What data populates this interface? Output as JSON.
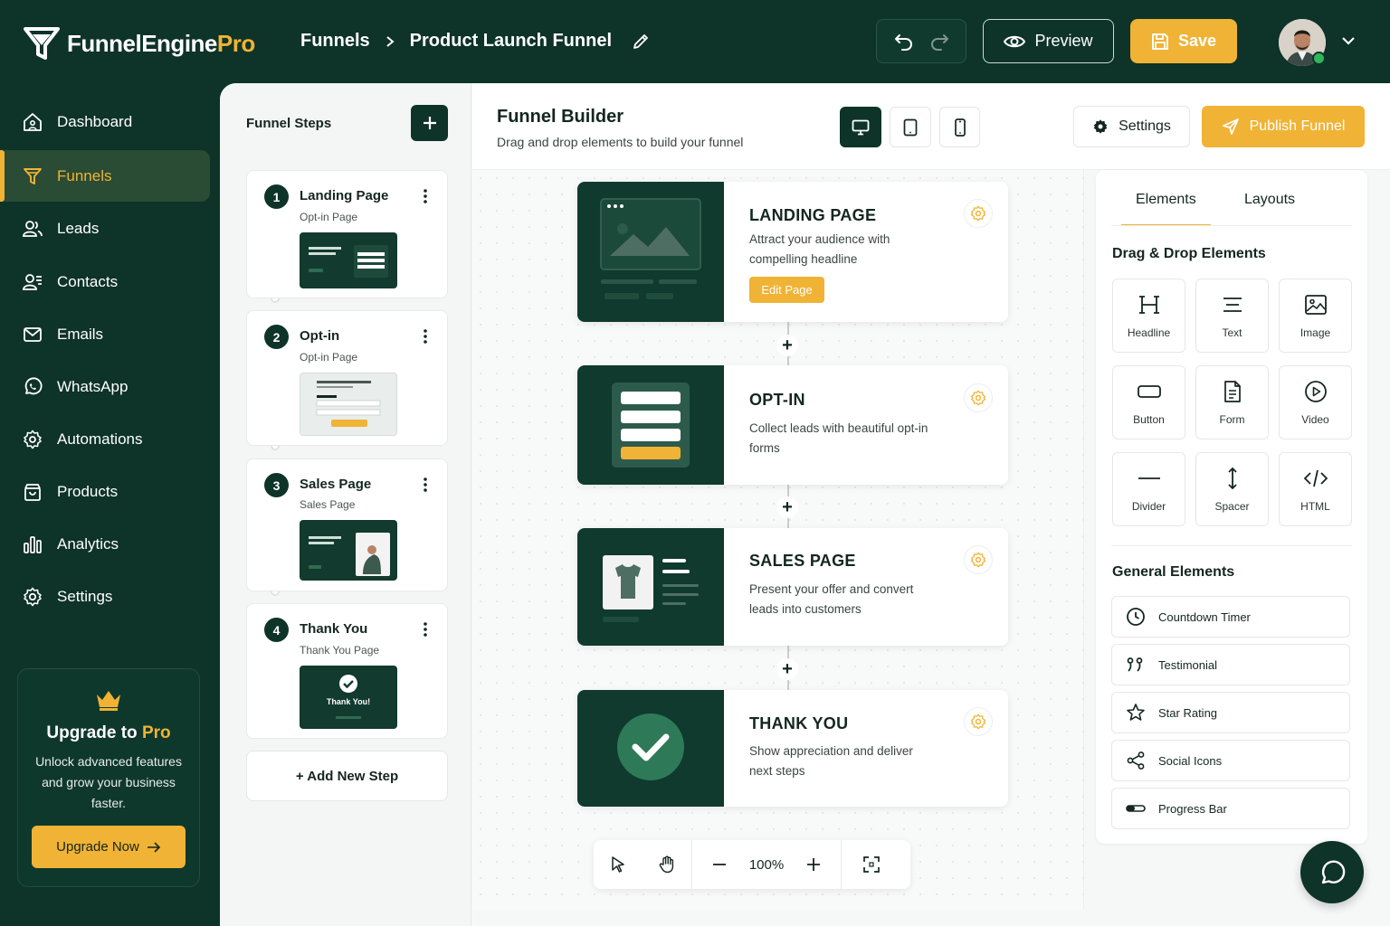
{
  "brand": {
    "name_main": "FunnelEngine",
    "name_accent": "Pro",
    "accent_color": "#f0b335",
    "dark_color": "#0e3328"
  },
  "header": {
    "breadcrumb_root": "Funnels",
    "breadcrumb_current": "Product Launch Funnel",
    "preview_label": "Preview",
    "save_label": "Save"
  },
  "sidebar": {
    "items": [
      {
        "label": "Dashboard",
        "icon": "home-icon"
      },
      {
        "label": "Funnels",
        "icon": "funnel-icon",
        "active": true
      },
      {
        "label": "Leads",
        "icon": "users-icon"
      },
      {
        "label": "Contacts",
        "icon": "contacts-icon"
      },
      {
        "label": "Emails",
        "icon": "mail-icon"
      },
      {
        "label": "WhatsApp",
        "icon": "whatsapp-icon"
      },
      {
        "label": "Automations",
        "icon": "cog-icon"
      },
      {
        "label": "Products",
        "icon": "bag-icon"
      },
      {
        "label": "Analytics",
        "icon": "bar-chart-icon"
      },
      {
        "label": "Settings",
        "icon": "gear-icon"
      }
    ],
    "upgrade": {
      "title_prefix": "Upgrade to",
      "title_accent": "Pro",
      "text": "Unlock advanced features and grow your business faster.",
      "button": "Upgrade Now"
    }
  },
  "steps_panel": {
    "title": "Funnel Steps",
    "steps": [
      {
        "num": "1",
        "title": "Landing Page",
        "sub": "Opt-in Page"
      },
      {
        "num": "2",
        "title": "Opt-in",
        "sub": "Opt-in Page"
      },
      {
        "num": "3",
        "title": "Sales Page",
        "sub": "Sales Page"
      },
      {
        "num": "4",
        "title": "Thank You",
        "sub": "Thank You Page",
        "thumb_text": "Thank You!"
      }
    ],
    "add_step": "+ Add New Step"
  },
  "builder": {
    "title": "Funnel Builder",
    "subtitle": "Drag and drop elements to build your funnel",
    "settings_label": "Settings",
    "publish_label": "Publish Funnel"
  },
  "funnel_cards": [
    {
      "title": "LANDING PAGE",
      "desc": "Attract your audience with compelling headline",
      "button": "Edit Page"
    },
    {
      "title": "OPT-IN",
      "desc": "Collect leads with beautiful opt-in forms"
    },
    {
      "title": "SALES PAGE",
      "desc": "Present your offer and convert leads into customers"
    },
    {
      "title": "THANK YOU",
      "desc": "Show appreciation and deliver next steps"
    }
  ],
  "zoom": {
    "level": "100%"
  },
  "right_panel": {
    "tabs": [
      "Elements",
      "Layouts"
    ],
    "drag_title": "Drag & Drop Elements",
    "tiles": [
      "Headline",
      "Text",
      "Image",
      "Button",
      "Form",
      "Video",
      "Divider",
      "Spacer",
      "HTML"
    ],
    "general_title": "General Elements",
    "general": [
      "Countdown Timer",
      "Testimonial",
      "Star Rating",
      "Social Icons",
      "Progress Bar"
    ]
  }
}
